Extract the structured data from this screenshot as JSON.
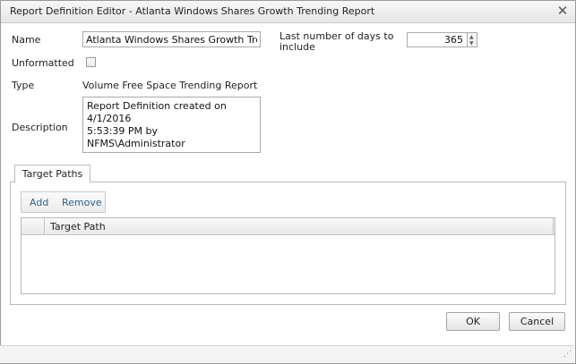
{
  "window": {
    "title": "Report Definition Editor - Atlanta Windows Shares Growth Trending Report"
  },
  "form": {
    "name_label": "Name",
    "name_value": "Atlanta Windows Shares Growth Trending Report",
    "days_label_line1": "Last number of days to",
    "days_label_line2": "include",
    "days_value": "365",
    "unformatted_label": "Unformatted",
    "unformatted_checked": false,
    "type_label": "Type",
    "type_value": "Volume Free Space Trending Report",
    "description_label": "Description",
    "description_line1": "Report Definition created on 4/1/2016",
    "description_line2": "5:53:39 PM by NFMS\\Administrator"
  },
  "tabs": [
    {
      "label": "Target Paths",
      "active": true
    }
  ],
  "toolbar": {
    "add_label": "Add",
    "remove_label": "Remove"
  },
  "grid": {
    "columns": [
      "Target Path"
    ],
    "rows": []
  },
  "buttons": {
    "ok": "OK",
    "cancel": "Cancel"
  },
  "icons": {
    "close": "close-icon",
    "resize": "resize-grip-icon"
  }
}
